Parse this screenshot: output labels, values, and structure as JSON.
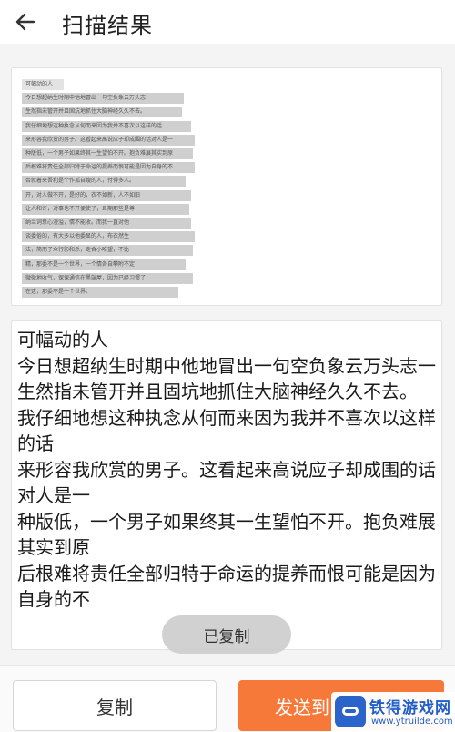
{
  "header": {
    "back_icon": "arrow-left-icon",
    "title": "扫描结果"
  },
  "source_image": {
    "lines": [
      "可幅动的人",
      "今日想超纳生时期中他地冒出一句空负象云万头志一",
      "生然指未管开并且固坑地抓住大脑神经久久不去。",
      "我仔细地想这种执念从何而来因为我并不喜次以这样的话",
      "来形容我欣赏的男子。这看起来高说应子却成围的话对人是一",
      "种版低，一个男子如果终其一生望怕不开。抱负难展其实到原",
      "后根难将责任全部归特于命运的提养而恨可能是因为自身的不",
      "否就着来吾利是个作孤自嫂的人，付得多人。",
      "开，对人做不开，是好的，衣不如新，人不如旧",
      "让人和许，对事也不开便使了，且期那些是尊",
      "纳兰词意心漫溢，情不能收。而我一直对他",
      "谈委俗的，有大多以他委显的人，布衣然生",
      "法，简而子众行影和杀，走合小唯望，不比",
      "精，那委不是一个世界，一个情各自攀附不定",
      "微微地收气，保保通信在黑端屋，因为已经习惯了",
      "在这，那委不是一个世界。"
    ]
  },
  "result": {
    "text": "可幅动的人\n今日想超纳生时期中他地冒出一句空负象云万头志一\n生然指未管开并且固坑地抓住大脑神经久久不去。\n我仔细地想这种执念从何而来因为我并不喜次以这样的话\n来形容我欣赏的男子。这看起来高说应子却成围的话对人是一\n种版低，一个男子如果终其一生望怕不开。抱负难展其实到原\n后根难将责任全部归特于命运的提养而恨可能是因为自身的不"
  },
  "toast": {
    "text": "已复制"
  },
  "actions": {
    "copy_label": "复制",
    "send_label": "发送到"
  },
  "watermark": {
    "name": "铁得游戏网",
    "url": "www.ytruilde.com"
  },
  "colors": {
    "accent": "#f7793a",
    "watermark": "#1f5fc7"
  }
}
